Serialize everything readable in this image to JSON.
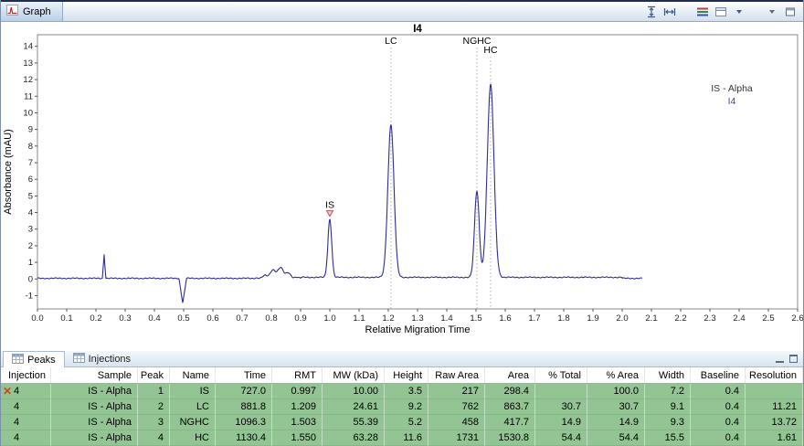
{
  "window": {
    "graph_tab": "Graph"
  },
  "chart_data": {
    "type": "line",
    "title": "I4",
    "xlabel": "Relative Migration Time",
    "ylabel": "Absorbance (mAU)",
    "xlim": [
      0.0,
      2.6
    ],
    "ylim": [
      -1.8,
      14.7
    ],
    "xtick_step": 0.1,
    "ytick_min": -1,
    "ytick_max": 14,
    "grid": false,
    "trace_color": "#2e2e8f",
    "trace_end": 2.07,
    "legend": {
      "position": "right",
      "sample": "IS - Alpha",
      "injection": "I4"
    },
    "peaks": [
      {
        "label": "IS",
        "x": 1.0,
        "height": 3.5,
        "sigma": 0.0065,
        "annotation": "marker"
      },
      {
        "label": "LC",
        "x": 1.209,
        "height": 9.2,
        "sigma": 0.0105,
        "annotation": "dotted-line",
        "label_row": 1
      },
      {
        "label": "NGHC",
        "x": 1.503,
        "height": 5.2,
        "sigma": 0.008,
        "annotation": "dotted-line",
        "label_row": 1
      },
      {
        "label": "HC",
        "x": 1.55,
        "height": 11.6,
        "sigma": 0.0115,
        "annotation": "dotted-line",
        "label_row": 2
      }
    ],
    "artifacts": [
      {
        "shape": "spike",
        "x": 0.228,
        "height": 1.45,
        "width": 0.006
      },
      {
        "shape": "spike",
        "x": 0.497,
        "height": -1.5,
        "width": 0.013
      },
      {
        "shape": "bump",
        "x": 0.825,
        "height": 0.55,
        "width": 0.028
      }
    ]
  },
  "bottom_panel": {
    "tabs": [
      {
        "label": "Peaks",
        "active": true
      },
      {
        "label": "Injections",
        "active": false
      }
    ]
  },
  "table": {
    "columns": [
      "Injection",
      "Sample",
      "Peak",
      "Name",
      "Time",
      "RMT",
      "MW (kDa)",
      "Height",
      "Raw Area",
      "Area",
      "% Total",
      "% Area",
      "Width",
      "Baseline",
      "Resolution"
    ],
    "marker_row": 0,
    "marker_symbol": "✕",
    "rows": [
      [
        "4",
        "IS - Alpha",
        "1",
        "IS",
        "727.0",
        "0.997",
        "10.00",
        "3.5",
        "217",
        "298.4",
        "",
        "100.0",
        "7.2",
        "0.4",
        ""
      ],
      [
        "4",
        "IS - Alpha",
        "2",
        "LC",
        "881.8",
        "1.209",
        "24.61",
        "9.2",
        "762",
        "863.7",
        "30.7",
        "30.7",
        "9.1",
        "0.4",
        "11.21"
      ],
      [
        "4",
        "IS - Alpha",
        "3",
        "NGHC",
        "1096.3",
        "1.503",
        "55.39",
        "5.2",
        "458",
        "417.7",
        "14.9",
        "14.9",
        "9.3",
        "0.4",
        "13.72"
      ],
      [
        "4",
        "IS - Alpha",
        "4",
        "HC",
        "1130.4",
        "1.550",
        "63.28",
        "11.6",
        "1731",
        "1530.8",
        "54.4",
        "54.4",
        "15.5",
        "0.4",
        "1.61"
      ]
    ]
  }
}
